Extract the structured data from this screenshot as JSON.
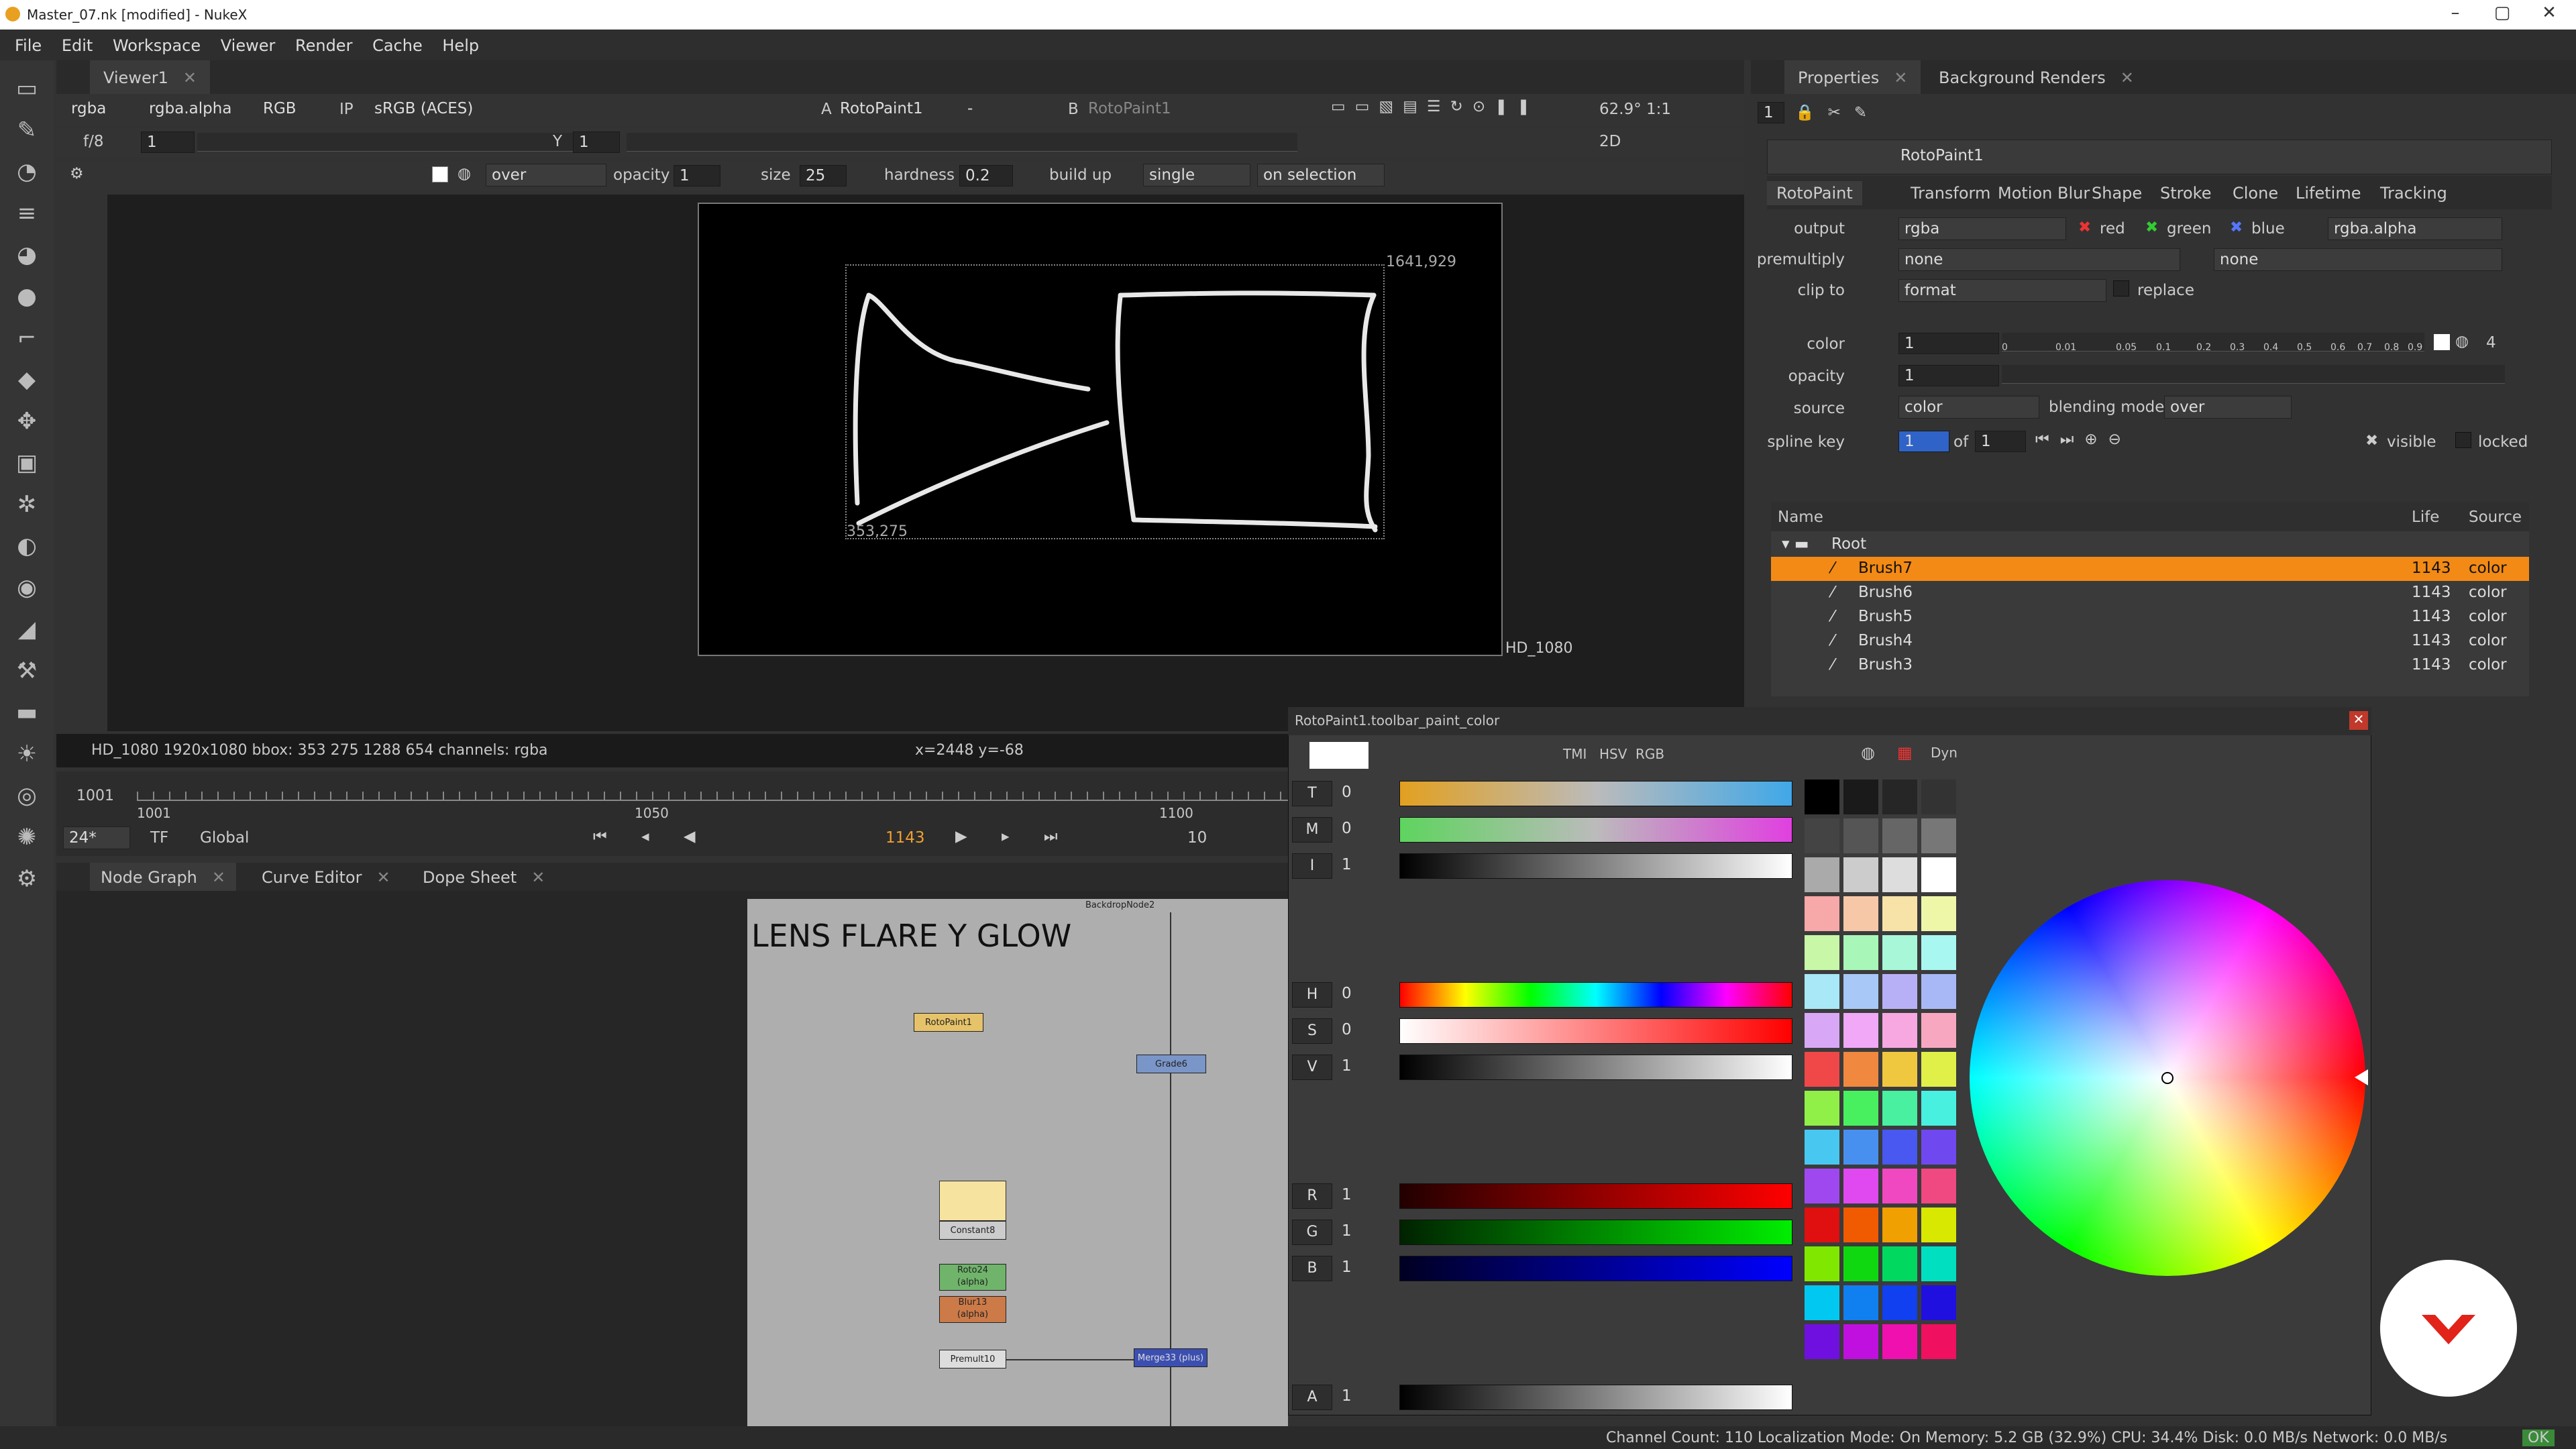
{
  "window": {
    "title": "Master_07.nk [modified] - NukeX"
  },
  "menu": [
    "File",
    "Edit",
    "Workspace",
    "Viewer",
    "Render",
    "Cache",
    "Help"
  ],
  "viewer": {
    "tab": "Viewer1",
    "channels": "rgba",
    "alpha": "rgba.alpha",
    "colorspace": "RGB",
    "ip": "IP",
    "lut": "sRGB (ACES)",
    "a_input": "A",
    "a_node": "RotoPaint1",
    "a_op": "-",
    "b_input": "B",
    "b_node": "RotoPaint1",
    "zoom": "62.9°",
    "ratio": "1:1",
    "fstop": "f/8",
    "frame_gain": "1",
    "y_label": "Y",
    "y_val": "1",
    "view_mode": "2D",
    "paint_blend": "over",
    "opacity_label": "opacity",
    "opacity": "1",
    "size_label": "size",
    "size": "25",
    "hardness_label": "hardness",
    "hardness": "0.2",
    "buildup_label": "build up",
    "stroke_mode": "single",
    "lifetime": "on selection",
    "bbox_tr": "1641,929",
    "bbox_bl": "353,275",
    "format": "HD_1080",
    "info": "HD_1080 1920x1080  bbox: 353 275 1288 654 channels: rgba",
    "coords": "x=2448 y=-68"
  },
  "timeline": {
    "start": "1001",
    "t1": "1001",
    "t2": "1050",
    "t3": "1100",
    "fps": "24*",
    "tf": "TF",
    "scope": "Global",
    "frame": "1143",
    "step": "10"
  },
  "panels": {
    "node_graph": "Node Graph",
    "curve_editor": "Curve Editor",
    "dope_sheet": "Dope Sheet"
  },
  "nodegraph": {
    "backdrop_name": "BackdropNode2",
    "backdrop_title": "LENS FLARE Y GLOW",
    "nodes": {
      "roto": "RotoPaint1",
      "grade": "Grade6",
      "constant": "Constant8",
      "roto2": "Roto24\n(alpha)",
      "blur": "Blur13\n(alpha)",
      "premult": "Premult10",
      "merge": "Merge33 (plus)"
    }
  },
  "properties": {
    "tab": "Properties",
    "bg_tab": "Background Renders",
    "node_name": "RotoPaint1",
    "count": "1",
    "tabs": [
      "RotoPaint",
      "Transform",
      "Motion Blur",
      "Shape",
      "Stroke",
      "Clone",
      "Lifetime",
      "Tracking"
    ],
    "output_label": "output",
    "output": "rgba",
    "red": "red",
    "green": "green",
    "blue": "blue",
    "output_alpha": "rgba.alpha",
    "premultiply_label": "premultiply",
    "premultiply": "none",
    "premultiply2": "none",
    "clip_label": "clip to",
    "clip": "format",
    "replace": "replace",
    "color_label": "color",
    "color_val": "1",
    "color_ch": "4",
    "opacity_label": "opacity",
    "opacity_val": "1",
    "source_label": "source",
    "source": "color",
    "blend_label": "blending mode",
    "blend": "over",
    "spline_label": "spline key",
    "spline_key": "1",
    "of_label": "of",
    "of_val": "1",
    "visible": "visible",
    "locked": "locked",
    "ticks": [
      "0",
      "0.01",
      "0.05",
      "0.1",
      "0.2",
      "0.3",
      "0.4",
      "0.5",
      "0.6",
      "0.7",
      "0.8",
      "0.9"
    ],
    "tree_cols": {
      "name": "Name",
      "life": "Life",
      "source": "Source"
    },
    "tree": [
      {
        "name": "Root",
        "life": "",
        "src": ""
      },
      {
        "name": "Brush7",
        "life": "1143",
        "src": "color"
      },
      {
        "name": "Brush6",
        "life": "1143",
        "src": "color"
      },
      {
        "name": "Brush5",
        "life": "1143",
        "src": "color"
      },
      {
        "name": "Brush4",
        "life": "1143",
        "src": "color"
      },
      {
        "name": "Brush3",
        "life": "1143",
        "src": "color"
      }
    ]
  },
  "colorpicker": {
    "title": "RotoPaint1.toolbar_paint_color",
    "modes": [
      "TMI",
      "HSV",
      "RGB"
    ],
    "dyn": "Dyn",
    "rows": [
      {
        "label": "T",
        "val": "0"
      },
      {
        "label": "M",
        "val": "0"
      },
      {
        "label": "I",
        "val": "1"
      },
      {
        "label": "H",
        "val": "0"
      },
      {
        "label": "S",
        "val": "0"
      },
      {
        "label": "V",
        "val": "1"
      },
      {
        "label": "R",
        "val": "1"
      },
      {
        "label": "G",
        "val": "1"
      },
      {
        "label": "B",
        "val": "1"
      },
      {
        "label": "A",
        "val": "1"
      }
    ]
  },
  "status": "Channel Count: 110  Localization Mode: On  Memory: 5.2 GB (32.9%)  CPU: 34.4%  Disk: 0.0 MB/s  Network: 0.0 MB/s",
  "status_ok": "OK",
  "icons": [
    "nuke-logo-icon",
    "minimize-icon",
    "maximize-icon",
    "close-icon",
    "select-icon",
    "paint-icon",
    "brush-icon",
    "eye-icon",
    "color-wheel-icon",
    "brand-logo-icon"
  ]
}
